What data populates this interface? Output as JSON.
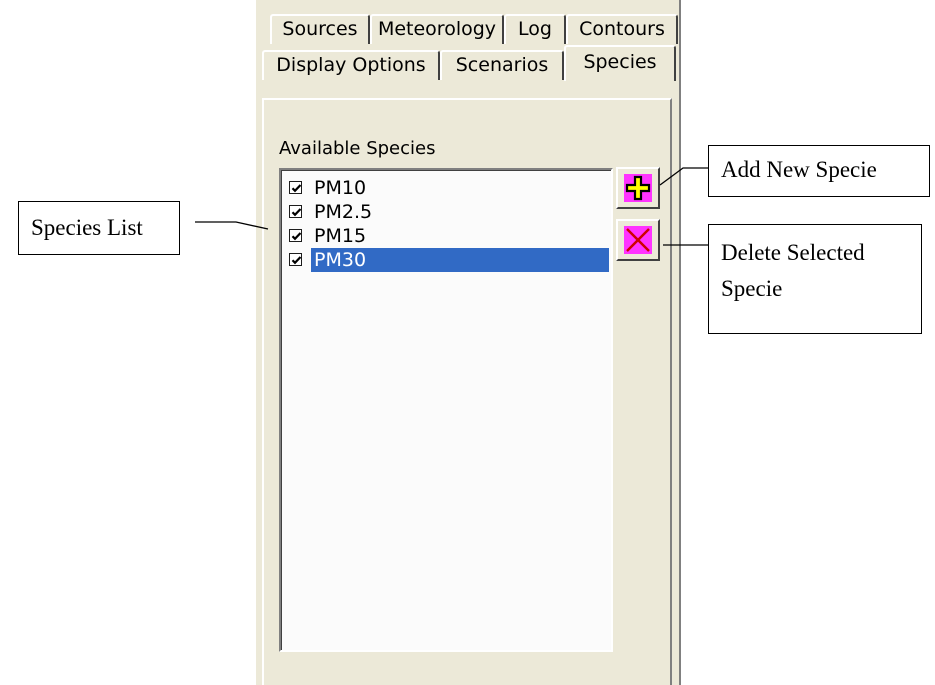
{
  "tabs_row1": [
    {
      "label": "Sources"
    },
    {
      "label": "Meteorology"
    },
    {
      "label": "Log"
    },
    {
      "label": "Contours"
    }
  ],
  "tabs_row2": [
    {
      "label": "Display Options"
    },
    {
      "label": "Scenarios"
    },
    {
      "label": "Species",
      "active": true
    }
  ],
  "species_panel": {
    "group_label": "Available Species",
    "items": [
      {
        "label": "PM10",
        "checked": true,
        "selected": false
      },
      {
        "label": "PM2.5",
        "checked": true,
        "selected": false
      },
      {
        "label": "PM15",
        "checked": true,
        "selected": false
      },
      {
        "label": "PM30",
        "checked": true,
        "selected": true
      }
    ],
    "add_button_icon": "plus-icon",
    "delete_button_icon": "x-icon"
  },
  "callouts": {
    "species_list": "Species List",
    "add_new": "Add New Specie",
    "delete_line1": "Delete Selected",
    "delete_line2": "Specie"
  },
  "colors": {
    "panel_bg": "#ece9d8",
    "selection": "#316ac5",
    "button_icon_bg": "#ff33ff",
    "plus_fill": "#ffff00"
  }
}
